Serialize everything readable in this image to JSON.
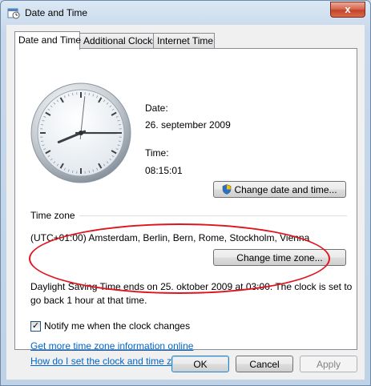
{
  "window": {
    "title": "Date and Time",
    "close_glyph": "x"
  },
  "tabs": [
    {
      "label": "Date and Time"
    },
    {
      "label": "Additional Clocks"
    },
    {
      "label": "Internet Time"
    }
  ],
  "clock": {
    "hour": 8,
    "minute": 15,
    "second": 1
  },
  "date": {
    "label": "Date:",
    "value": "26. september 2009"
  },
  "time": {
    "label": "Time:",
    "value": "08:15:01"
  },
  "buttons": {
    "change_date_time": "Change date and time...",
    "change_time_zone": "Change time zone...",
    "ok": "OK",
    "cancel": "Cancel",
    "apply": "Apply"
  },
  "timezone": {
    "heading": "Time zone",
    "value": "(UTC+01:00) Amsterdam, Berlin, Bern, Rome, Stockholm, Vienna"
  },
  "dst_info": {
    "line1": "Daylight Saving Time ends on 25. oktober 2009 at 03:00. The clock is set to",
    "line2": "go back 1 hour at that time."
  },
  "notify": {
    "label": "Notify me when the clock changes",
    "checked": true,
    "check_glyph": "✓"
  },
  "links": {
    "more_info": "Get more time zone information online",
    "how_to": "How do I set the clock and time zone?"
  },
  "annotation": {
    "color": "#e0141e"
  }
}
